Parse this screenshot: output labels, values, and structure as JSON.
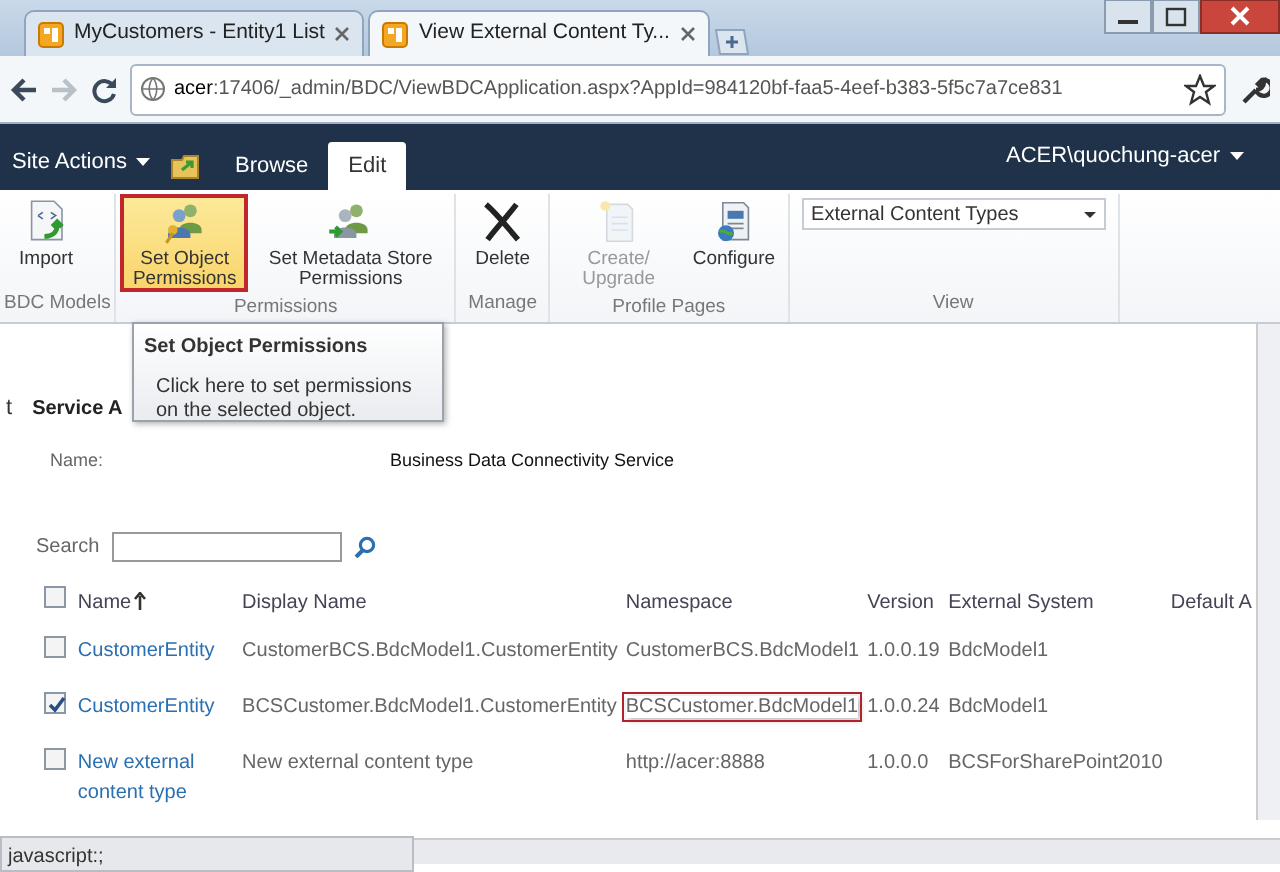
{
  "browser": {
    "tabs": [
      {
        "title": "MyCustomers - Entity1 List",
        "selected": false
      },
      {
        "title": "View External Content Ty...",
        "selected": true
      }
    ],
    "address": {
      "host": "acer",
      "path": ":17406/_admin/BDC/ViewBDCApplication.aspx?AppId=984120bf-faa5-4eef-b383-5f5c7a7ce831"
    }
  },
  "site_actions": "Site Actions",
  "ribbon_tabs": [
    {
      "label": "Browse",
      "selected": false
    },
    {
      "label": "Edit",
      "selected": true
    }
  ],
  "user": "ACER\\quochung-acer",
  "ribbon_groups": [
    {
      "label": "BDC Models",
      "buttons": [
        {
          "label": "Import",
          "highlighted": false,
          "disabled": false
        }
      ]
    },
    {
      "label": "Permissions",
      "buttons": [
        {
          "label": "Set Object Permissions",
          "highlighted": true,
          "disabled": false
        },
        {
          "label": "Set Metadata Store Permissions",
          "highlighted": false,
          "disabled": false
        }
      ]
    },
    {
      "label": "Manage",
      "buttons": [
        {
          "label": "Delete",
          "highlighted": false,
          "disabled": false
        }
      ]
    },
    {
      "label": "Profile Pages",
      "buttons": [
        {
          "label": "Create/ Upgrade",
          "highlighted": false,
          "disabled": true
        },
        {
          "label": "Configure",
          "highlighted": false,
          "disabled": false
        }
      ]
    },
    {
      "label": "View",
      "dropdown": "External Content Types"
    }
  ],
  "tooltip": {
    "title": "Set Object Permissions",
    "text": "Click here to set permissions on the selected object."
  },
  "edge_text": "t",
  "service": {
    "heading": "Service A",
    "name_label": "Name:",
    "name_value": "Business Data Connectivity Service"
  },
  "search": {
    "label": "Search"
  },
  "table": {
    "columns": [
      {
        "label": "Name",
        "sorted": true
      },
      {
        "label": "Display Name",
        "sorted": false
      },
      {
        "label": "Namespace",
        "sorted": false
      },
      {
        "label": "Version",
        "sorted": false
      },
      {
        "label": "External System",
        "sorted": false
      },
      {
        "label": "Default A",
        "sorted": false
      }
    ],
    "header_checked": false,
    "rows": [
      {
        "checked": false,
        "name": "CustomerEntity",
        "display_name": "CustomerBCS.BdcModel1.CustomerEntity",
        "namespace": "CustomerBCS.BdcModel1",
        "namespace_highlighted": false,
        "version": "1.0.0.19",
        "external_system": "BdcModel1"
      },
      {
        "checked": true,
        "name": "CustomerEntity",
        "display_name": "BCSCustomer.BdcModel1.CustomerEntity",
        "namespace": "BCSCustomer.BdcModel1",
        "namespace_highlighted": true,
        "version": "1.0.0.24",
        "external_system": "BdcModel1"
      },
      {
        "checked": false,
        "name": "New external content type",
        "display_name": "New external content type",
        "namespace": "http://acer:8888",
        "namespace_highlighted": false,
        "version": "1.0.0.0",
        "external_system": "BCSForSharePoint2010"
      }
    ]
  },
  "status_bar": "javascript:;"
}
